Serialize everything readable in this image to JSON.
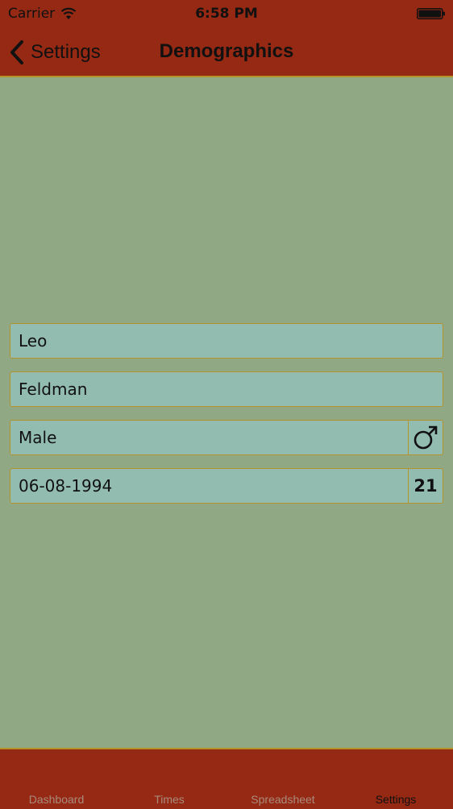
{
  "status_bar": {
    "carrier": "Carrier",
    "time": "6:58 PM",
    "icons": [
      "wifi-icon",
      "battery-icon"
    ]
  },
  "nav": {
    "back_label": "Settings",
    "title": "Demographics"
  },
  "form": {
    "first_name": "Leo",
    "last_name": "Feldman",
    "gender": "Male",
    "gender_icon": "male-symbol-icon",
    "birthdate": "06-08-1994",
    "age": "21"
  },
  "tabs": [
    {
      "label": "Dashboard",
      "active": false
    },
    {
      "label": "Times",
      "active": false
    },
    {
      "label": "Spreadsheet",
      "active": false
    },
    {
      "label": "Settings",
      "active": true
    }
  ],
  "colors": {
    "header": "#962913",
    "background": "#91a884",
    "field": "#93bcb0",
    "border": "#b5932b"
  }
}
